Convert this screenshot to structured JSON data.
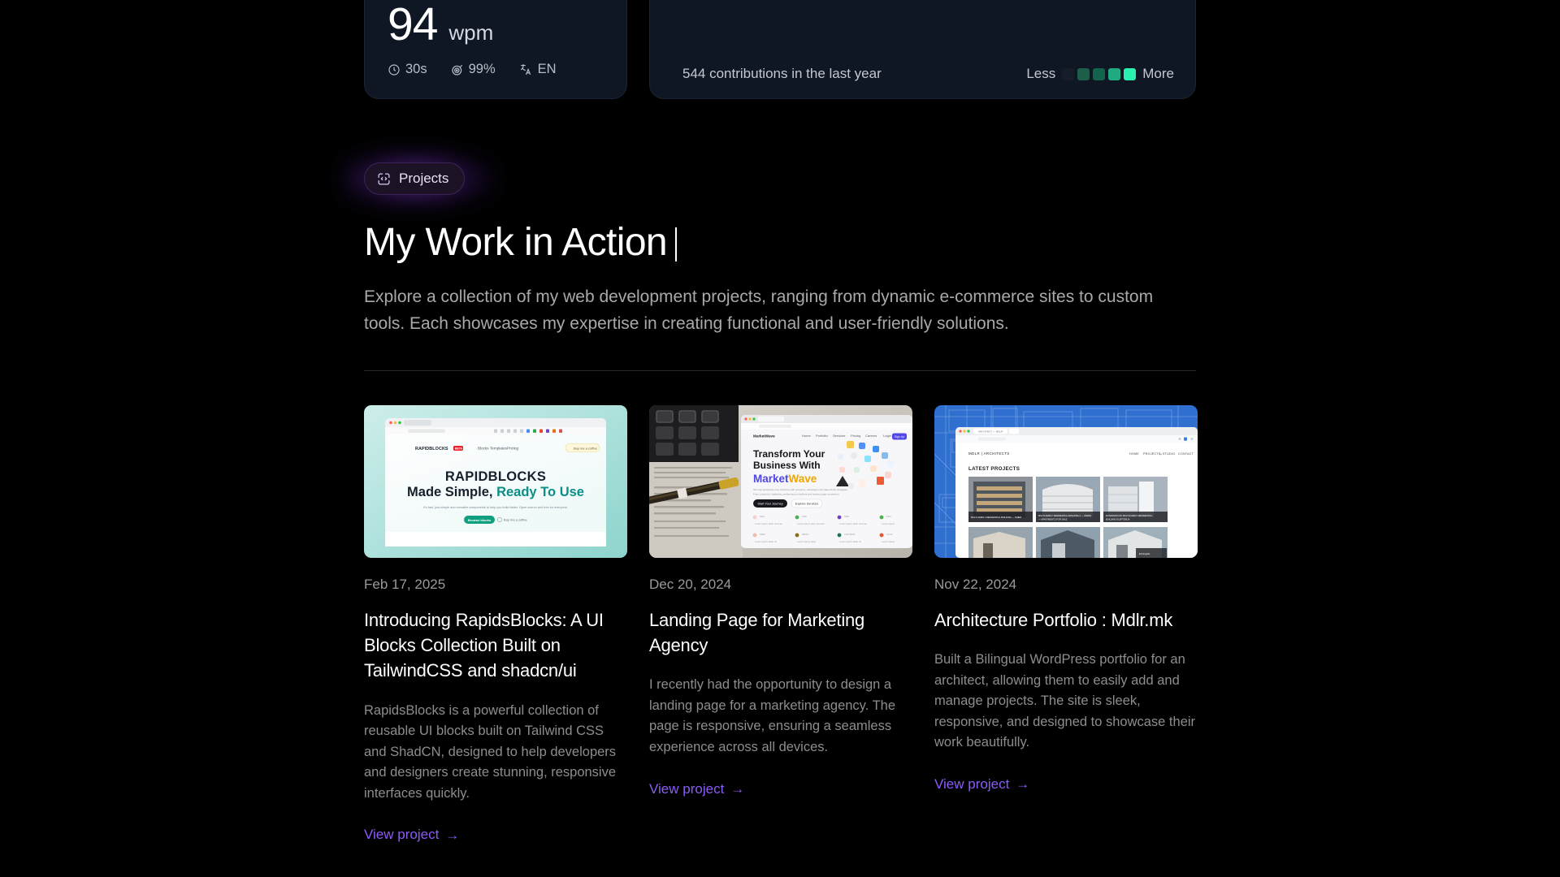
{
  "typing_card": {
    "ghost_number": "94",
    "wpm_value": "94",
    "wpm_unit": "wpm",
    "duration": "30s",
    "accuracy": "99%",
    "language": "EN",
    "icons": {
      "duration": "clock-icon",
      "accuracy": "target-icon",
      "language": "translate-icon"
    }
  },
  "contributions_card": {
    "count_text": "544 contributions in the last year",
    "legend_less": "Less",
    "legend_more": "More",
    "legend_colors": [
      "#161d29",
      "#1d5e4a",
      "#14634d",
      "#1faa7f",
      "#2bf0b0"
    ],
    "levels": {
      "0": "#161d29",
      "1": "#1d5e4a",
      "2": "#14634d",
      "3": "#1faa7f",
      "4": "#2bf0b0"
    }
  },
  "projects_section": {
    "badge_label": "Projects",
    "badge_icon": "code-braces-square-icon",
    "title": "My Work in Action",
    "lede": "Explore a collection of my web development projects, ranging from dynamic e-commerce sites to custom tools. Each showcases my expertise in creating functional and user-friendly solutions.",
    "accent_color": "#8b5cf6"
  },
  "projects": [
    {
      "date": "Feb 17, 2025",
      "title": "Introducing RapidsBlocks: A UI Blocks Collection Built on TailwindCSS and shadcn/ui",
      "description": "RapidsBlocks is a powerful collection of reusable UI blocks built on Tailwind CSS and ShadCN, designed to help developers and designers create stunning, responsive interfaces quickly.",
      "link_label": "View project",
      "link_arrow": "→",
      "thumb": {
        "alt": "rapidsblocks-landing-page-screenshot",
        "brand": "RAPIDBLOCKS",
        "badge": "BETA",
        "headline_1": "RAPIDBLOCKS",
        "headline_2a": "Made Simple, ",
        "headline_2b": "Ready To Use",
        "subtext": "It's fast, just simple and reusable components to help you build faster. Open source and free for everyone.",
        "cta_primary": "Browse blocks",
        "cta_secondary": "Buy me a coffee",
        "nav": [
          "Blocks",
          "Templates",
          "Pricing"
        ],
        "bg_from": "#bfe9e4",
        "bg_to": "#8fd6cf",
        "accent": "#0f9a8d"
      }
    },
    {
      "date": "Dec 20, 2024",
      "title": "Landing Page for Marketing Agency",
      "description": "I recently had the opportunity to design a landing page for a marketing agency. The page is responsive, ensuring a seamless experience across all devices.",
      "link_label": "View project",
      "link_arrow": "→",
      "thumb": {
        "alt": "marketwave-landing-page-screenshot",
        "brand": "MarketWave",
        "headline_1": "Transform Your",
        "headline_2": "Business With",
        "headline_3a": "Market",
        "headline_3b": "Wave",
        "cta_primary": "Start Your Journey",
        "cta_secondary": "Explore Services",
        "nav": [
          "Home",
          "Portfolio",
          "Services",
          "Pricing",
          "Careers"
        ],
        "login": "Login",
        "signup": "Sign Up",
        "accent": "#4f46e5",
        "accent_2": "#f0a500"
      }
    },
    {
      "date": "Nov 22, 2024",
      "title": "Architecture Portfolio : Mdlr.mk",
      "description": "Built a Bilingual WordPress portfolio for an architect, allowing them to easily add and manage projects. The site is sleek, responsive, and designed to showcase their work beautifully.",
      "link_label": "View project",
      "link_arrow": "→",
      "thumb": {
        "alt": "mdlr-architects-portfolio-screenshot",
        "brand": "MDLR | ARCHITECTS",
        "section_title": "LATEST PROJECTS",
        "nav": [
          "HOME",
          "PROJECTS",
          "STUDIO",
          "CONTACT"
        ],
        "captions": [
          "MULTI-FAMILY RESIDENTIAL BUILDING — SHIED",
          "MULTI-FAMILY RESIDENTIAL BUILDING 2 — OHRID APARTMENTS FOR SALE",
          "EXTENSION OF MULTI-FAMILY RESIDENTIAL BUILDING ELEFTERIJA"
        ],
        "bg": "#2f6fd0"
      }
    }
  ]
}
